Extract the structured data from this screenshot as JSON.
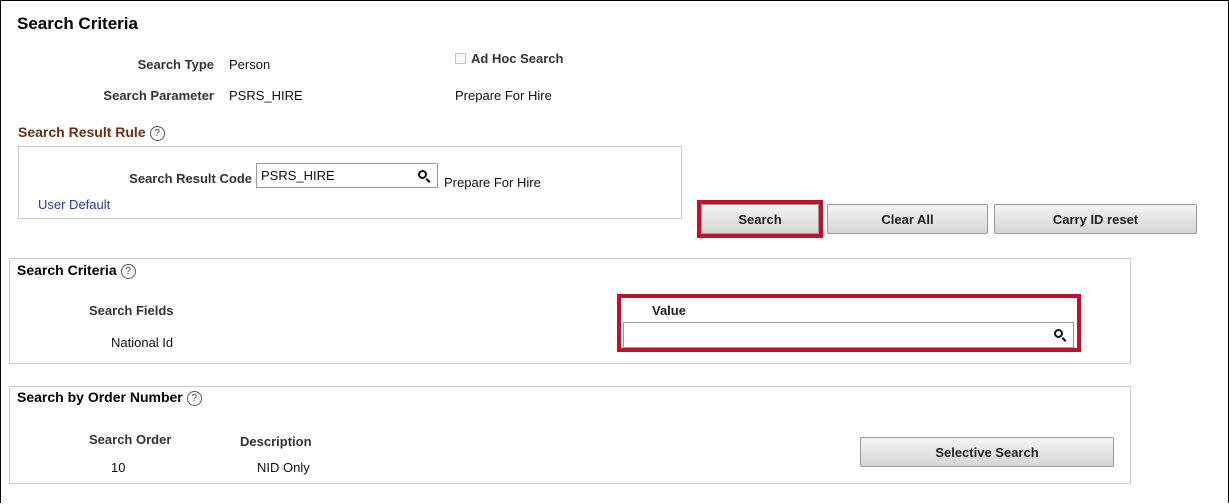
{
  "page_title": "Search Criteria",
  "header": {
    "search_type_label": "Search Type",
    "search_type_value": "Person",
    "ad_hoc_label": "Ad Hoc Search",
    "search_parameter_label": "Search Parameter",
    "search_parameter_value": "PSRS_HIRE",
    "search_parameter_desc": "Prepare For Hire"
  },
  "result_rule": {
    "title": "Search Result Rule",
    "code_label": "Search Result Code",
    "code_value": "PSRS_HIRE",
    "code_desc": "Prepare For Hire",
    "user_default_link": "User Default"
  },
  "actions": {
    "search": "Search",
    "clear_all": "Clear All",
    "carry_id_reset": "Carry ID reset"
  },
  "criteria": {
    "title": "Search Criteria",
    "fields_header": "Search Fields",
    "value_header": "Value",
    "field_name": "National Id",
    "field_value": ""
  },
  "order": {
    "title": "Search by Order Number",
    "order_header": "Search Order",
    "desc_header": "Description",
    "rows": [
      {
        "order": "10",
        "description": "NID Only"
      }
    ],
    "selective_search": "Selective Search"
  },
  "icons": {
    "help": "help-circle-icon",
    "lookup": "magnifier-icon"
  },
  "colors": {
    "highlight": "#c0102a",
    "section_title": "#6b2f16",
    "link": "#1f3c99"
  }
}
